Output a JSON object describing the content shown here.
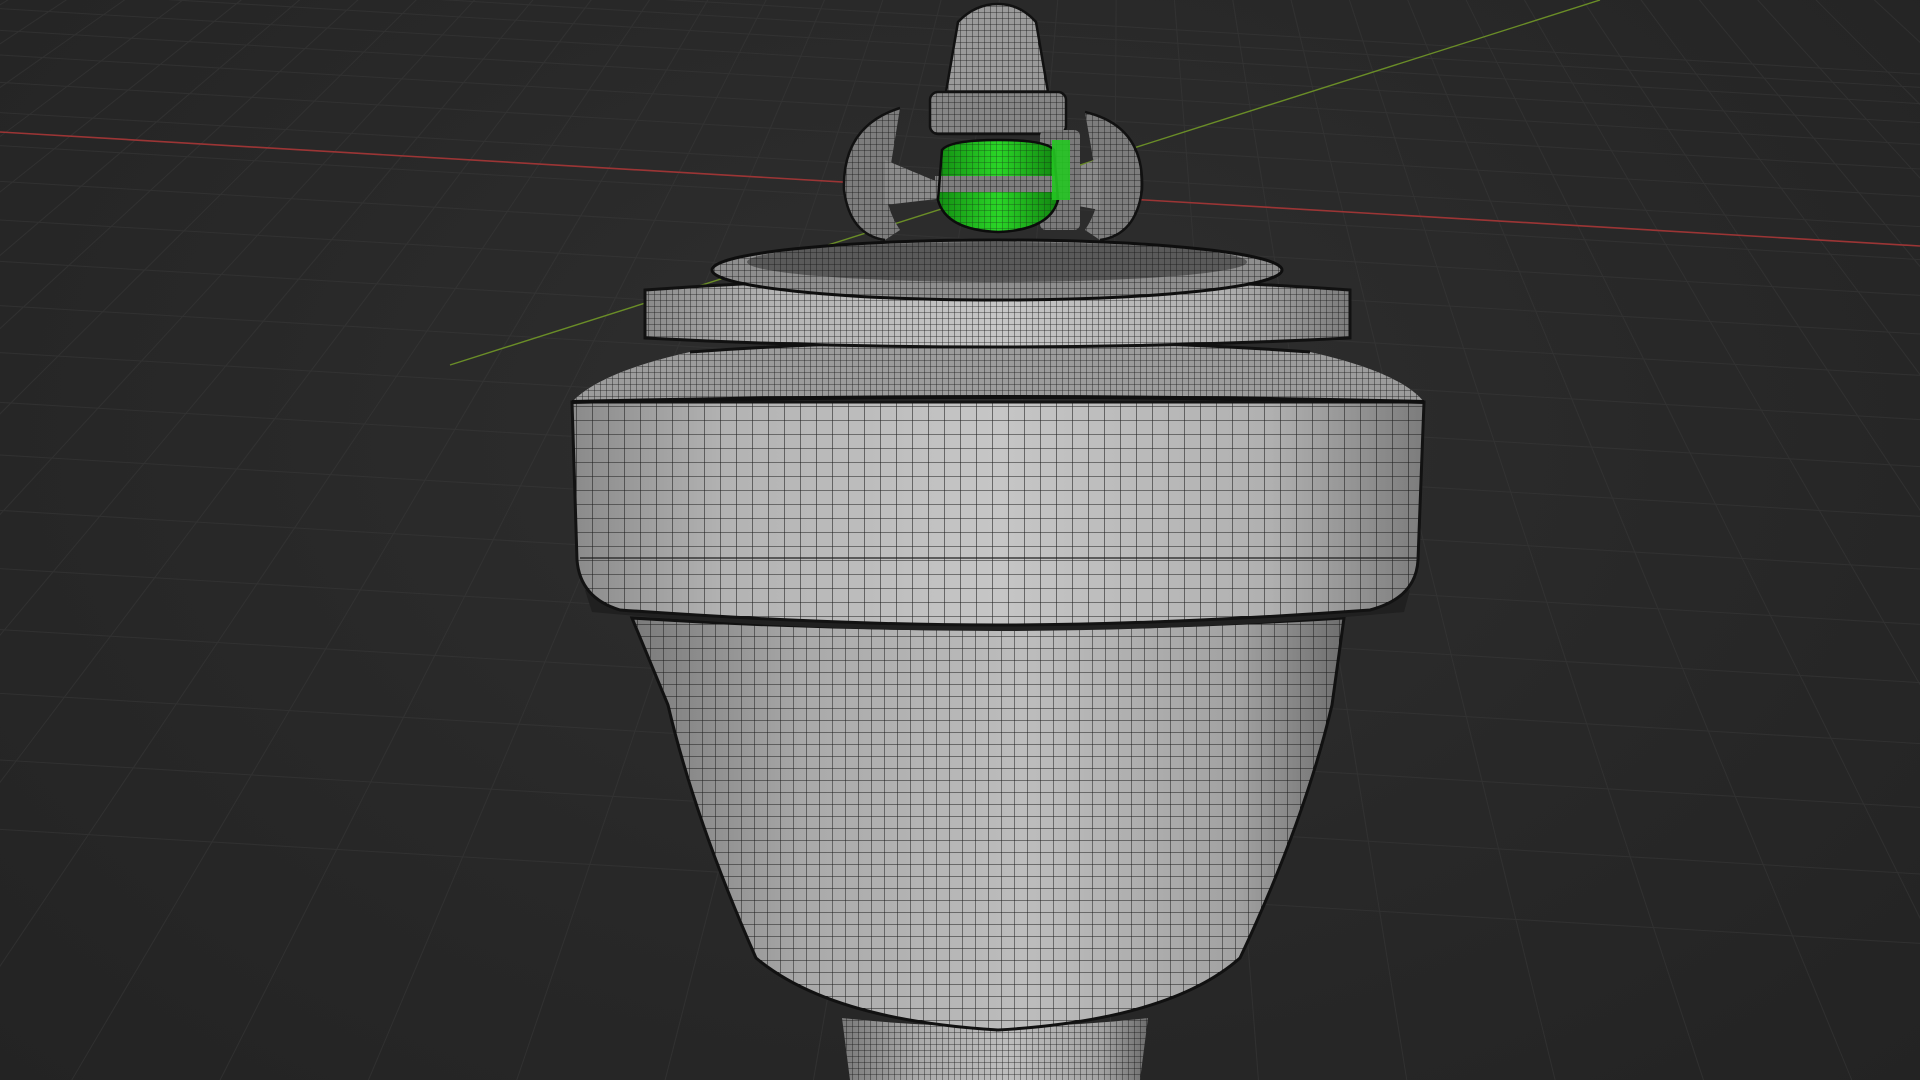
{
  "viewport": {
    "background_color": "#282828",
    "grid_color": "#3a3a3a",
    "x_axis_color": "#a33a3a",
    "y_axis_color": "#6b8f2a"
  },
  "model": {
    "mesh_color": "#b8b8b8",
    "wire_color": "#1a1a1a",
    "selected_color": "#22c41f",
    "display_mode": "wireframe-overlay"
  }
}
